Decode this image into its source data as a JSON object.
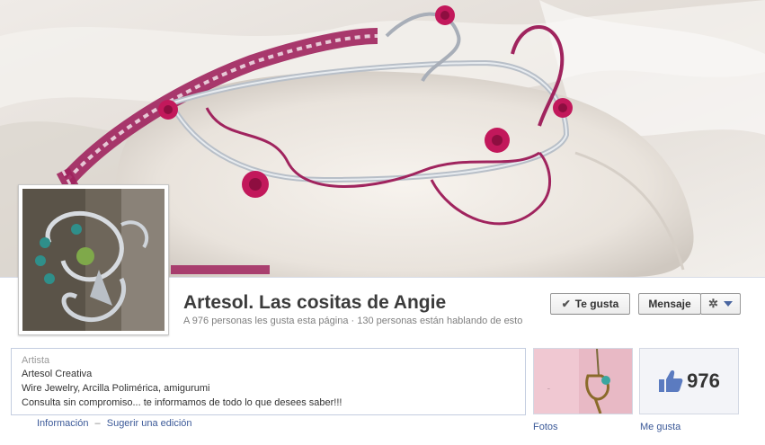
{
  "page": {
    "name": "Artesol. Las cositas de Angie",
    "stats_likes": "A 976 personas les gusta esta página",
    "stats_separator": "·",
    "stats_talking": "130 personas están hablando de esto"
  },
  "actions": {
    "like_label": "Te gusta",
    "message_label": "Mensaje"
  },
  "about": {
    "category": "Artista",
    "lines": [
      "Artesol Creativa",
      "Wire Jewelry, Arcilla Polimérica, amigurumi",
      "Consulta sin compromiso... te informamos de todo lo que desees saber!!!"
    ],
    "info_link": "Información",
    "edit_link": "Sugerir una edición",
    "link_separator": "–"
  },
  "tiles": {
    "photos_label": "Fotos",
    "likes_label": "Me gusta",
    "likes_count": "976"
  },
  "icons": {
    "like_check": "check-icon",
    "gear": "gear-icon",
    "caret": "caret-down-icon",
    "thumbs_up": "thumbs-up-icon"
  },
  "colors": {
    "link": "#3b5998",
    "wire": "#b8bfc8",
    "rose": "#c2185b",
    "ribbon": "#a0245e"
  }
}
